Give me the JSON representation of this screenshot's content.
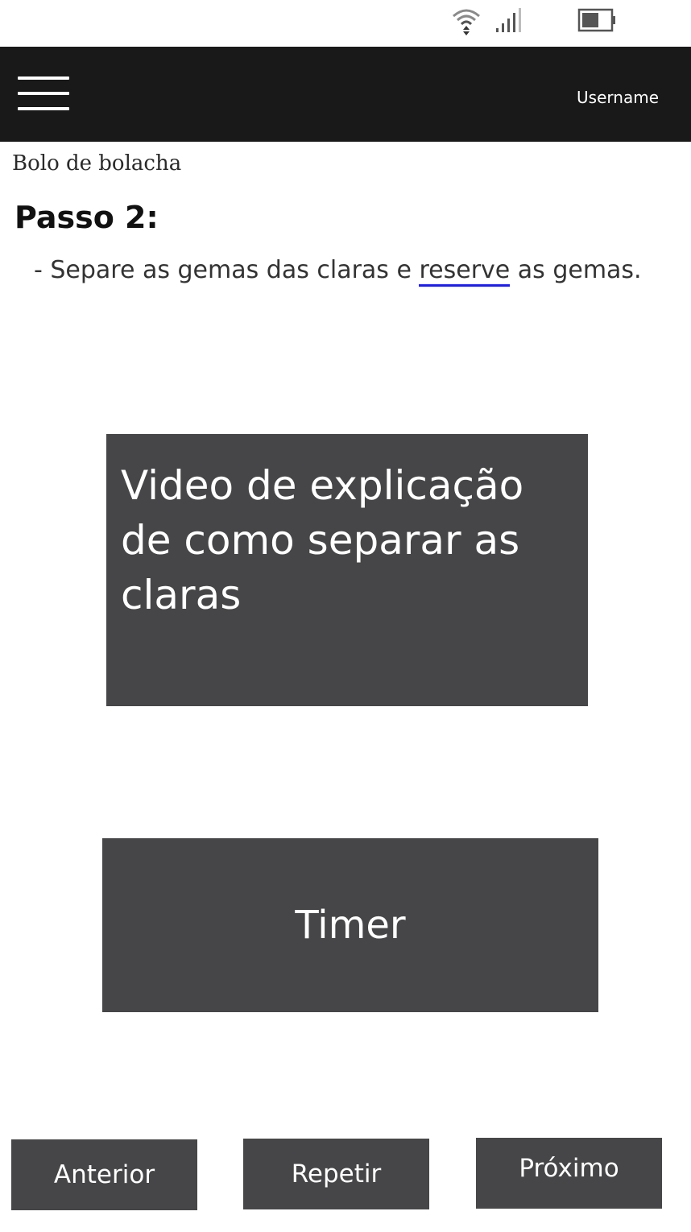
{
  "status_bar": {
    "wifi_icon": "wifi-icon",
    "signal_icon": "signal-icon",
    "battery_icon": "battery-icon"
  },
  "header": {
    "menu_icon": "hamburger-menu-icon",
    "username": "Username",
    "background": "#191919"
  },
  "recipe": {
    "name": "Bolo de bolacha",
    "step_title": "Passo 2:",
    "step_text_before": "- Separe as gemas das claras e ",
    "step_link": "reserve",
    "step_text_after": " as gemas."
  },
  "video": {
    "label": "Video de explicação de como separar as claras"
  },
  "timer": {
    "label": "Timer"
  },
  "navigation": {
    "previous_label": "Anterior",
    "repeat_label": "Repetir",
    "next_label": "Próximo"
  },
  "colors": {
    "panel": "#464648",
    "link_underline": "#1a1aff"
  }
}
